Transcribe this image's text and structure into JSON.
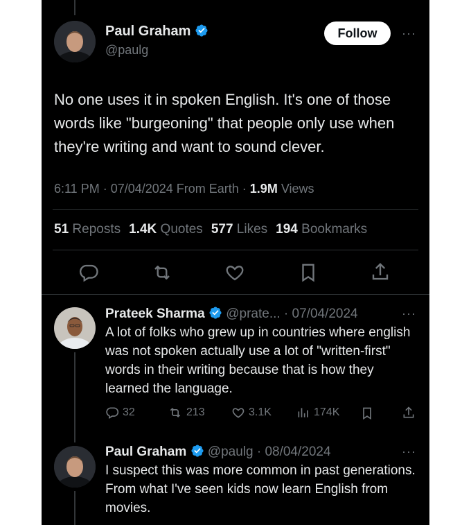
{
  "main_tweet": {
    "author": {
      "name": "Paul Graham",
      "handle": "@paulg"
    },
    "follow_label": "Follow",
    "more_label": "···",
    "text": "No one uses it in spoken English. It's one of those words like \"burgeoning\" that people only use when they're writing and want to sound clever.",
    "meta": {
      "time_date": "6:11 PM · 07/04/2024 From Earth · ",
      "views_count": "1.9M",
      "views_label": " Views"
    },
    "stats": [
      {
        "count": "51",
        "label": "Reposts"
      },
      {
        "count": "1.4K",
        "label": "Quotes"
      },
      {
        "count": "577",
        "label": "Likes"
      },
      {
        "count": "194",
        "label": "Bookmarks"
      }
    ],
    "actions": [
      "reply-icon",
      "repost-icon",
      "like-icon",
      "bookmark-icon",
      "share-icon"
    ]
  },
  "replies": [
    {
      "name": "Prateek Sharma",
      "handle_date": "@prate... · 07/04/2024",
      "text": "A lot of folks who grew up in countries where english was not spoken actually use a lot of \"written-first\" words in their writing because that is how they learned the language.",
      "actions": {
        "replies": "32",
        "reposts": "213",
        "likes": "3.1K",
        "views": "174K"
      }
    },
    {
      "name": "Paul Graham",
      "handle_date": "@paulg · 08/04/2024",
      "text": "I suspect this was more common in past generations. From what I've seen kids now learn English from movies."
    }
  ],
  "colors": {
    "background": "#000000",
    "text": "#e7e9ea",
    "muted": "#71767b",
    "verified": "#1d9bf0",
    "divider": "#2f3336"
  }
}
